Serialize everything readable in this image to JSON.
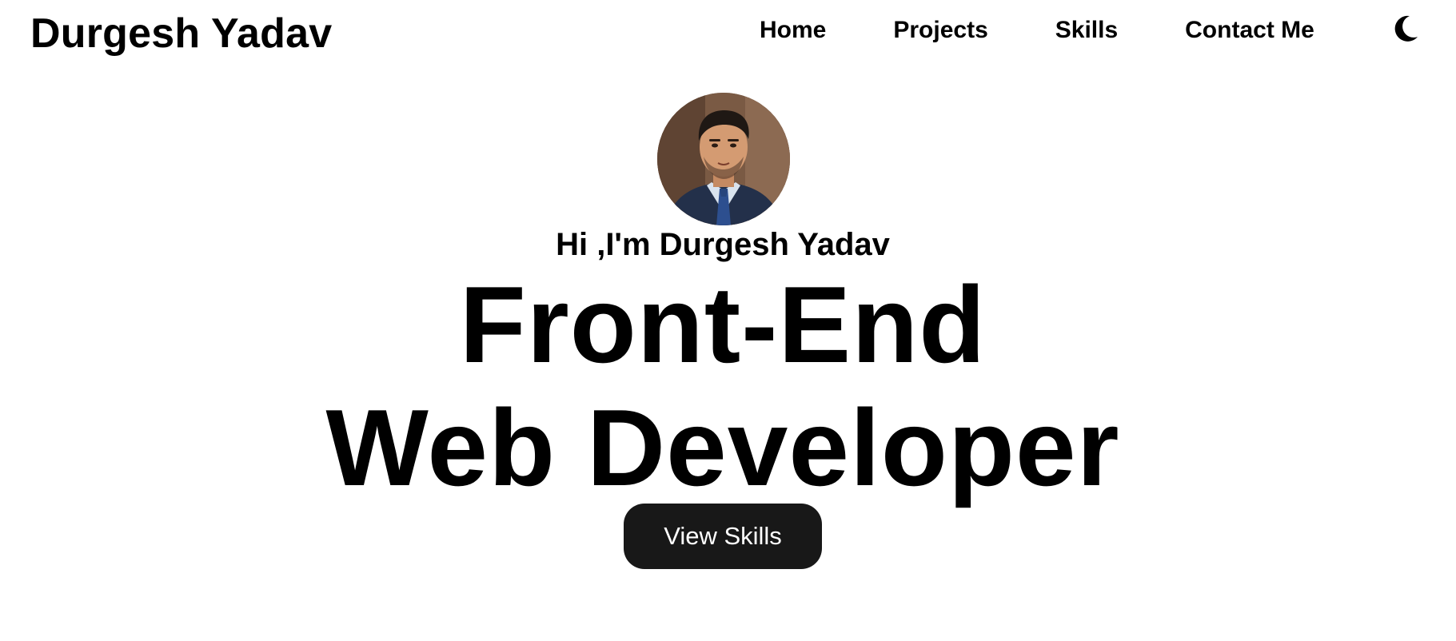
{
  "header": {
    "brand": "Durgesh Yadav",
    "nav": {
      "home": "Home",
      "projects": "Projects",
      "skills": "Skills",
      "contact": "Contact Me"
    },
    "theme_toggle_icon": "moon-icon"
  },
  "hero": {
    "avatar_icon": "profile-photo",
    "greeting": "Hi ,I'm Durgesh Yadav",
    "headline_line1": "Front-End",
    "headline_line2": "Web Developer",
    "cta_label": "View Skills"
  },
  "colors": {
    "text": "#000000",
    "background": "#ffffff",
    "button_bg": "#181818",
    "button_text": "#ffffff"
  }
}
